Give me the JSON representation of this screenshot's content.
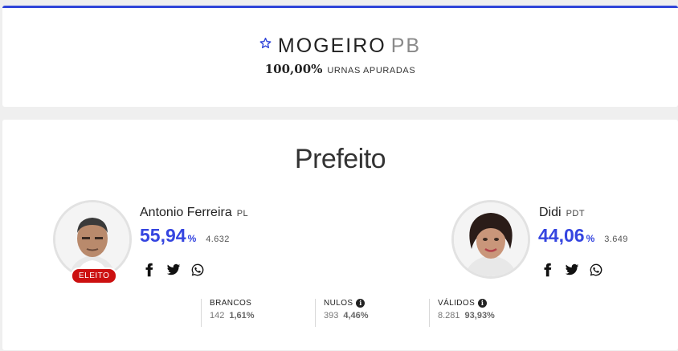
{
  "header": {
    "city": "MOGEIRO",
    "state": "PB",
    "urnas_pct": "100,00%",
    "urnas_label": "URNAS APURADAS"
  },
  "race": {
    "title": "Prefeito",
    "candidates": [
      {
        "name": "Antonio Ferreira",
        "party": "PL",
        "pct": "55,94",
        "pct_sign": "%",
        "votes": "4.632",
        "badge": "ELEITO"
      },
      {
        "name": "Didi",
        "party": "PDT",
        "pct": "44,06",
        "pct_sign": "%",
        "votes": "3.649"
      }
    ],
    "stats": [
      {
        "label": "BRANCOS",
        "count": "142",
        "pct": "1,61%"
      },
      {
        "label": "NULOS",
        "count": "393",
        "pct": "4,46%"
      },
      {
        "label": "VÁLIDOS",
        "count": "8.281",
        "pct": "93,93%"
      }
    ]
  },
  "colors": {
    "accent": "#3045d8",
    "elected": "#cc1010",
    "pct": "#3545e0"
  },
  "icons": [
    "star-icon",
    "facebook-icon",
    "twitter-icon",
    "whatsapp-icon",
    "info-icon"
  ]
}
